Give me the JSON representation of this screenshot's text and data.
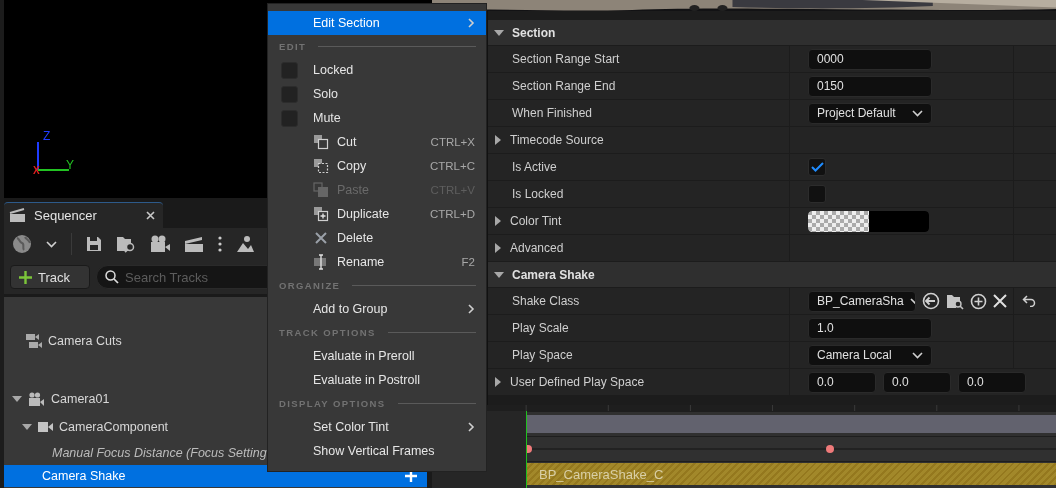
{
  "viewport": {
    "axes": [
      {
        "label": "Z",
        "color": "#1f3cff"
      },
      {
        "label": "Y",
        "color": "#22c322"
      },
      {
        "label": "X",
        "color": "#e02020"
      }
    ]
  },
  "sequencer": {
    "title": "Sequencer",
    "track_button": "Track",
    "search": {
      "placeholder": "Search Tracks"
    },
    "tree": [
      {
        "label": "Camera Cuts",
        "kind": "cuts",
        "selected": false
      },
      {
        "label": "Camera01",
        "kind": "actor",
        "expanded": true,
        "selected": false,
        "children": [
          {
            "label": "CameraComponent",
            "kind": "component",
            "expanded": true,
            "selected": false,
            "children": [
              {
                "label": "Manual Focus Distance (Focus Setting",
                "kind": "property",
                "selected": false
              }
            ]
          },
          {
            "label": "Camera Shake",
            "kind": "track",
            "selected": true
          }
        ]
      }
    ]
  },
  "context_menu": {
    "items": [
      {
        "kind": "submenu",
        "label": "Edit Section",
        "selected": true
      },
      {
        "kind": "heading",
        "label": "EDIT"
      },
      {
        "kind": "check",
        "label": "Locked",
        "checked": false
      },
      {
        "kind": "check",
        "label": "Solo",
        "checked": false
      },
      {
        "kind": "check",
        "label": "Mute",
        "checked": false
      },
      {
        "kind": "command",
        "label": "Cut",
        "shortcut": "CTRL+X",
        "disabled": false
      },
      {
        "kind": "command",
        "label": "Copy",
        "shortcut": "CTRL+C",
        "disabled": false
      },
      {
        "kind": "command",
        "label": "Paste",
        "shortcut": "CTRL+V",
        "disabled": true
      },
      {
        "kind": "command",
        "label": "Duplicate",
        "shortcut": "CTRL+D",
        "disabled": false
      },
      {
        "kind": "command",
        "label": "Delete",
        "disabled": false
      },
      {
        "kind": "command",
        "label": "Rename",
        "shortcut": "F2",
        "disabled": false
      },
      {
        "kind": "heading",
        "label": "ORGANIZE"
      },
      {
        "kind": "submenu",
        "label": "Add to Group",
        "selected": false
      },
      {
        "kind": "heading",
        "label": "TRACK OPTIONS"
      },
      {
        "kind": "plain",
        "label": "Evaluate in Preroll"
      },
      {
        "kind": "plain",
        "label": "Evaluate in Postroll"
      },
      {
        "kind": "heading",
        "label": "DISPLAY OPTIONS"
      },
      {
        "kind": "submenu",
        "label": "Set Color Tint",
        "selected": false
      },
      {
        "kind": "plain",
        "label": "Show Vertical Frames"
      }
    ]
  },
  "details": {
    "sections": [
      {
        "title": "Section",
        "expanded": true,
        "rows": [
          {
            "label": "Section Range Start",
            "kind": "number",
            "value": "0000"
          },
          {
            "label": "Section Range End",
            "kind": "number",
            "value": "0150"
          },
          {
            "label": "When Finished",
            "kind": "dropdown",
            "value": "Project Default"
          },
          {
            "label": "Timecode Source",
            "kind": "group",
            "expanded": false
          },
          {
            "label": "Is Active",
            "kind": "checkbox",
            "checked": true
          },
          {
            "label": "Is Locked",
            "kind": "checkbox",
            "checked": false
          },
          {
            "label": "Color Tint",
            "kind": "color",
            "expanded": false
          },
          {
            "label": "Advanced",
            "kind": "group",
            "expanded": false
          }
        ]
      },
      {
        "title": "Camera Shake",
        "expanded": true,
        "rows": [
          {
            "label": "Shake Class",
            "kind": "class",
            "value": "BP_CameraSha"
          },
          {
            "label": "Play Scale",
            "kind": "number",
            "value": "1.0"
          },
          {
            "label": "Play Space",
            "kind": "dropdown",
            "value": "Camera Local"
          },
          {
            "label": "User Defined Play Space",
            "kind": "vector",
            "expanded": false,
            "values": [
              "0.0",
              "0.0",
              "0.0"
            ]
          }
        ]
      }
    ]
  },
  "timeline": {
    "section_label": "BP_CameraShake_C"
  }
}
